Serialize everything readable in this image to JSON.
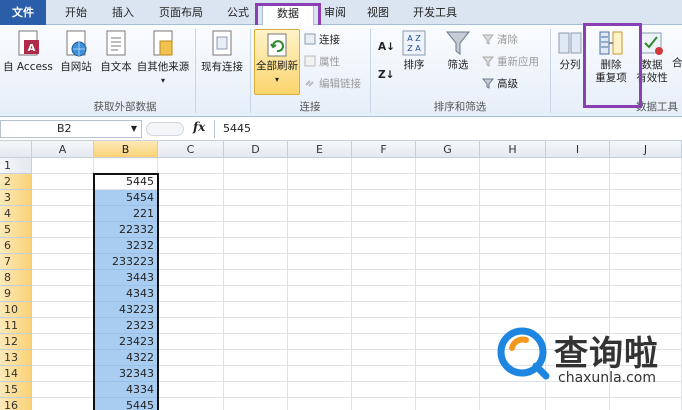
{
  "tabs": [
    {
      "label": "文件",
      "left": 0
    },
    {
      "label": "开始"
    },
    {
      "label": "插入"
    },
    {
      "label": "页面布局"
    },
    {
      "label": "公式"
    },
    {
      "label": "数据"
    },
    {
      "label": "审阅"
    },
    {
      "label": "视图"
    },
    {
      "label": "开发工具"
    }
  ],
  "ribbon": {
    "external": {
      "access": "自 Access",
      "web": "自网站",
      "text": "自文本",
      "other": "自其他来源",
      "existing": "现有连接",
      "group_label": "获取外部数据"
    },
    "connections": {
      "refresh_all": "全部刷新",
      "connections": "连接",
      "properties": "属性",
      "edit_links": "编辑链接",
      "group_label": "连接"
    },
    "sort": {
      "sort": "排序",
      "filter": "筛选",
      "clear": "清除",
      "reapply": "重新应用",
      "advanced": "高级",
      "group_label": "排序和筛选"
    },
    "tools": {
      "split": "分列",
      "remove_dup_1": "删除",
      "remove_dup_2": "重复项",
      "validation_1": "数据",
      "validation_2": "有效性",
      "group_label": "数据工具"
    }
  },
  "formula_bar": {
    "name_box": "B2",
    "fx": "fx",
    "value": "5445"
  },
  "grid": {
    "columns": [
      "A",
      "B",
      "C",
      "D",
      "E",
      "F",
      "G",
      "H",
      "I",
      "J"
    ],
    "rows": [
      "1",
      "2",
      "3",
      "4",
      "5",
      "6",
      "7",
      "8",
      "9",
      "10",
      "11",
      "12",
      "13",
      "14",
      "15",
      "16"
    ],
    "b_values": [
      "",
      "5445",
      "5454",
      "221",
      "22332",
      "3232",
      "233223",
      "3443",
      "4343",
      "43223",
      "2323",
      "23423",
      "4322",
      "32343",
      "4334",
      "5445"
    ]
  },
  "watermark": {
    "title": "查询啦",
    "url": "chaxunla.com"
  },
  "colors": {
    "highlight": "#8b3fb5",
    "file_tab": "#2a5ea8",
    "selection": "#a9cdf1"
  }
}
